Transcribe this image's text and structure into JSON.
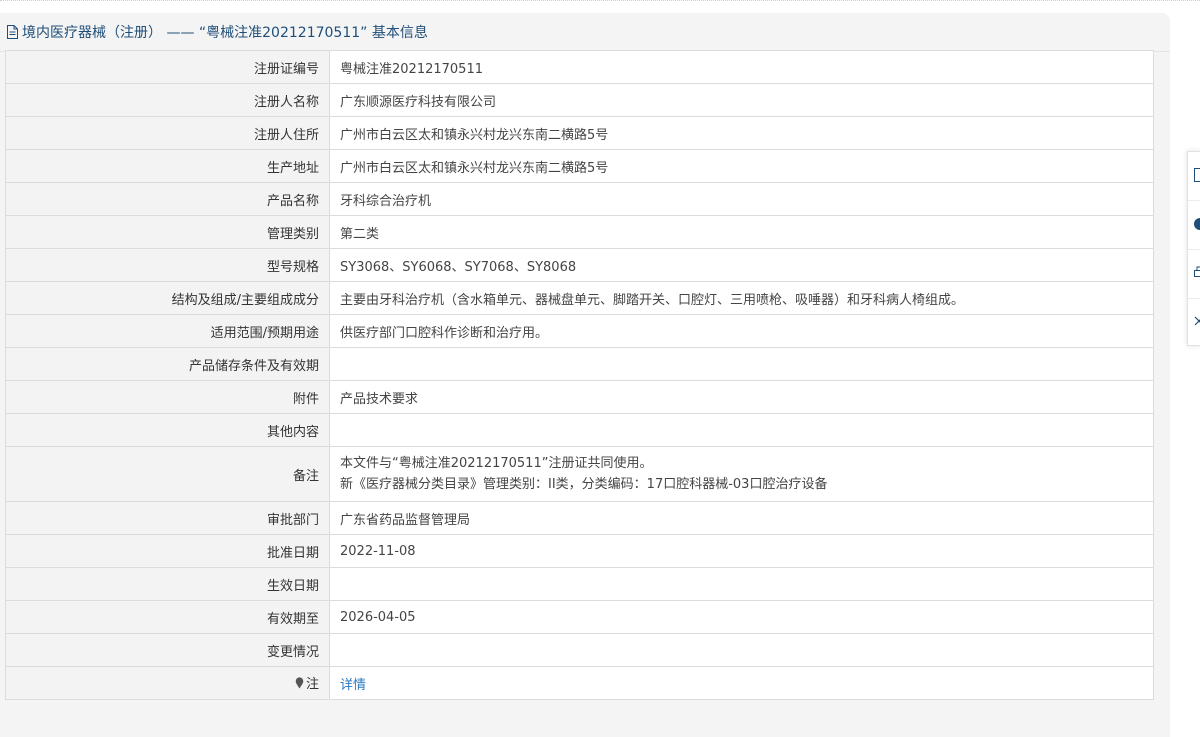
{
  "header": {
    "title": "境内医疗器械（注册） —— “粤械注准20212170511” 基本信息",
    "icon": "document-icon"
  },
  "rows": [
    {
      "label": "注册证编号",
      "value": "粤械注准20212170511"
    },
    {
      "label": "注册人名称",
      "value": "广东顺源医疗科技有限公司"
    },
    {
      "label": "注册人住所",
      "value": "广州市白云区太和镇永兴村龙兴东南二横路5号"
    },
    {
      "label": "生产地址",
      "value": "广州市白云区太和镇永兴村龙兴东南二横路5号"
    },
    {
      "label": "产品名称",
      "value": "牙科综合治疗机"
    },
    {
      "label": "管理类别",
      "value": "第二类"
    },
    {
      "label": "型号规格",
      "value": "SY3068、SY6068、SY7068、SY8068"
    },
    {
      "label": "结构及组成/主要组成成分",
      "value": "主要由牙科治疗机（含水箱单元、器械盘单元、脚踏开关、口腔灯、三用喷枪、吸唾器）和牙科病人椅组成。"
    },
    {
      "label": "适用范围/预期用途",
      "value": "供医疗部门口腔科作诊断和治疗用。"
    },
    {
      "label": "产品储存条件及有效期",
      "value": ""
    },
    {
      "label": "附件",
      "value": "产品技术要求"
    },
    {
      "label": "其他内容",
      "value": ""
    },
    {
      "label": "备注",
      "value_line1": "本文件与“粤械注准20212170511”注册证共同使用。",
      "value_line2": "新《医疗器械分类目录》管理类别：II类，分类编码：17口腔科器械-03口腔治疗设备"
    },
    {
      "label": "审批部门",
      "value": "广东省药品监督管理局"
    },
    {
      "label": "批准日期",
      "value": "2022-11-08"
    },
    {
      "label": "生效日期",
      "value": ""
    },
    {
      "label": "有效期至",
      "value": "2026-04-05"
    },
    {
      "label": "变更情况",
      "value": ""
    },
    {
      "label": "注",
      "value": "详情",
      "icon": "pin-icon"
    }
  ],
  "side_toolbar": {
    "icons": [
      "document-icon",
      "info-icon",
      "print-icon",
      "close-icon"
    ]
  },
  "colors": {
    "header_text": "#1f4e79",
    "link": "#2b78c2",
    "label_bg": "#f3f3f3",
    "panel_bg": "#f4f4f4"
  }
}
